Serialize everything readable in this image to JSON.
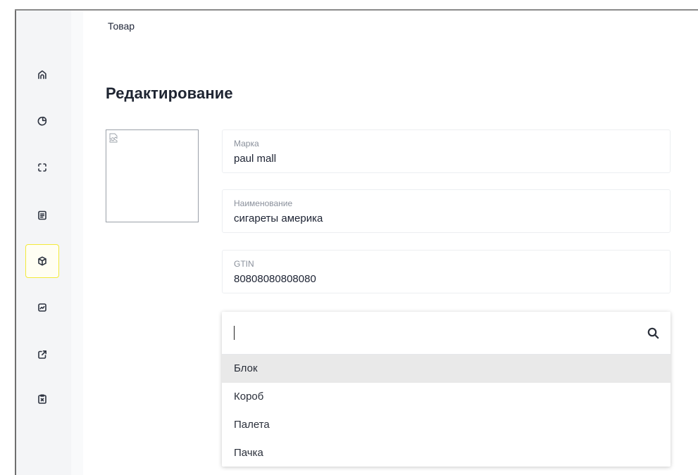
{
  "breadcrumb": {
    "current": "Товар"
  },
  "page": {
    "title": "Редактирование"
  },
  "sidebar": {
    "items": [
      {
        "icon": "home-icon",
        "active": false
      },
      {
        "icon": "pie-chart-icon",
        "active": false
      },
      {
        "icon": "scan-icon",
        "active": false
      },
      {
        "icon": "document-icon",
        "active": false
      },
      {
        "icon": "box-icon",
        "active": true
      },
      {
        "icon": "chart-box-icon",
        "active": false
      },
      {
        "icon": "external-link-icon",
        "active": false
      },
      {
        "icon": "clipboard-x-icon",
        "active": false
      }
    ],
    "active_color": "#f3ea3a"
  },
  "form": {
    "brand": {
      "label": "Марка",
      "value": "paul mall"
    },
    "name": {
      "label": "Наименование",
      "value": "сигареты америка"
    },
    "gtin": {
      "label": "GTIN",
      "value": "80808080808080"
    }
  },
  "dropdown": {
    "search_value": "",
    "options": [
      "Блок",
      "Короб",
      "Палета",
      "Пачка"
    ],
    "highlighted_index": 0
  }
}
